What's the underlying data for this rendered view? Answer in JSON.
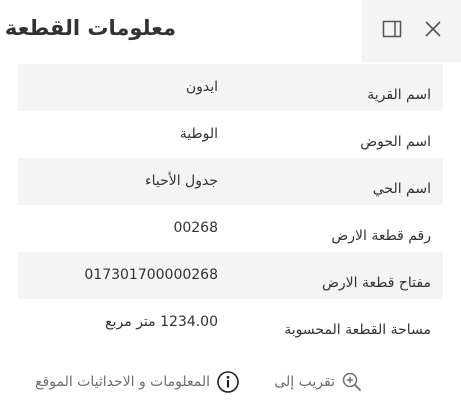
{
  "header": {
    "title": "معلومات القطعة",
    "icons": {
      "dock": "dock-panel-icon",
      "close": "close-icon"
    }
  },
  "rows": [
    {
      "label": "اسم القرية",
      "value": "ايدون"
    },
    {
      "label": "اسم الحوض",
      "value": "الوطية"
    },
    {
      "label": "اسم الحي",
      "value": "جدول الأحياء"
    },
    {
      "label": "رقم قطعة الارض",
      "value": "00268"
    },
    {
      "label": "مفتاح قطعة الارض",
      "value": "017301700000268"
    },
    {
      "label": "مساحة القطعة المحسوبة",
      "value": "1234.00 متر مربع"
    }
  ],
  "footer": {
    "zoom_label": "تقريب إلى",
    "info_label": "المعلومات و الاحداثيات الموقع",
    "icons": {
      "zoom": "zoom-in-icon",
      "info": "info-icon"
    }
  },
  "colors": {
    "text": "#323232",
    "muted": "#6e6e6e",
    "row_shade": "#f4f4f4",
    "header_bg": "#f4f4f4"
  }
}
